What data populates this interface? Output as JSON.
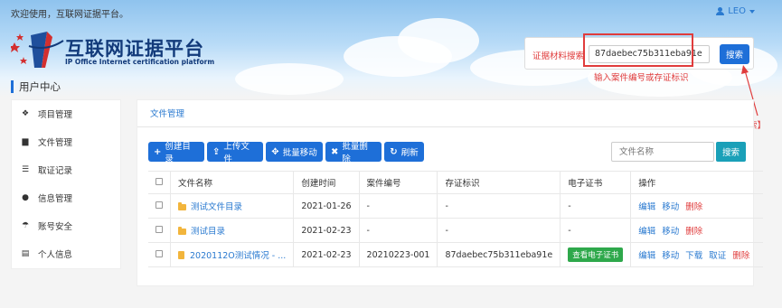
{
  "header": {
    "welcome": "欢迎使用，互联网证据平台。",
    "user_name": "LEO",
    "logo_title": "互联网证据平台",
    "logo_subtitle": "IP Office Internet certification platform"
  },
  "search": {
    "label": "证据材料搜索",
    "value": "87daebec75b311eba91e",
    "button": "搜索"
  },
  "annotations": {
    "input_hint": "输入案件编号或存证标识",
    "click_hint": "点击【搜索】",
    "color": "#e03c3c"
  },
  "user_center": {
    "title": "用户中心",
    "menu": [
      {
        "label": "项目管理",
        "icon": "cubes-icon"
      },
      {
        "label": "文件管理",
        "icon": "file-icon"
      },
      {
        "label": "取证记录",
        "icon": "database-icon"
      },
      {
        "label": "信息管理",
        "icon": "comment-icon"
      },
      {
        "label": "账号安全",
        "icon": "umbrella-icon"
      },
      {
        "label": "个人信息",
        "icon": "id-card-icon"
      }
    ]
  },
  "main": {
    "tab": "文件管理",
    "toolbar": {
      "create_dir": "创建目录",
      "upload": "上传文件",
      "batch_move": "批量移动",
      "batch_delete": "批量删除",
      "refresh": "刷新"
    },
    "filter": {
      "placeholder": "文件名称",
      "button": "搜索"
    },
    "table": {
      "headers": [
        "文件名称",
        "创建时间",
        "案件编号",
        "存证标识",
        "电子证书",
        "操作"
      ],
      "rows": [
        {
          "name": "测试文件目录",
          "created": "2021-01-26",
          "case_no": "-",
          "tag": "-",
          "cert": "-",
          "ops": [
            "编辑",
            "移动",
            "删除"
          ]
        },
        {
          "name": "测试目录",
          "created": "2021-02-23",
          "case_no": "-",
          "tag": "-",
          "cert": "-",
          "ops": [
            "编辑",
            "移动",
            "删除"
          ]
        },
        {
          "name": "2020112O测试情况 - ...",
          "created": "2021-02-23",
          "case_no": "20210223-001",
          "tag": "87daebec75b311eba91e",
          "cert": "查看电子证书",
          "ops": [
            "编辑",
            "移动",
            "下载",
            "取证",
            "删除"
          ]
        }
      ]
    }
  },
  "colors": {
    "primary": "#1e6fd8",
    "link": "#2a7ad0",
    "danger": "#e03c3c",
    "success": "#2ea84b",
    "teal": "#1aa0b8"
  }
}
